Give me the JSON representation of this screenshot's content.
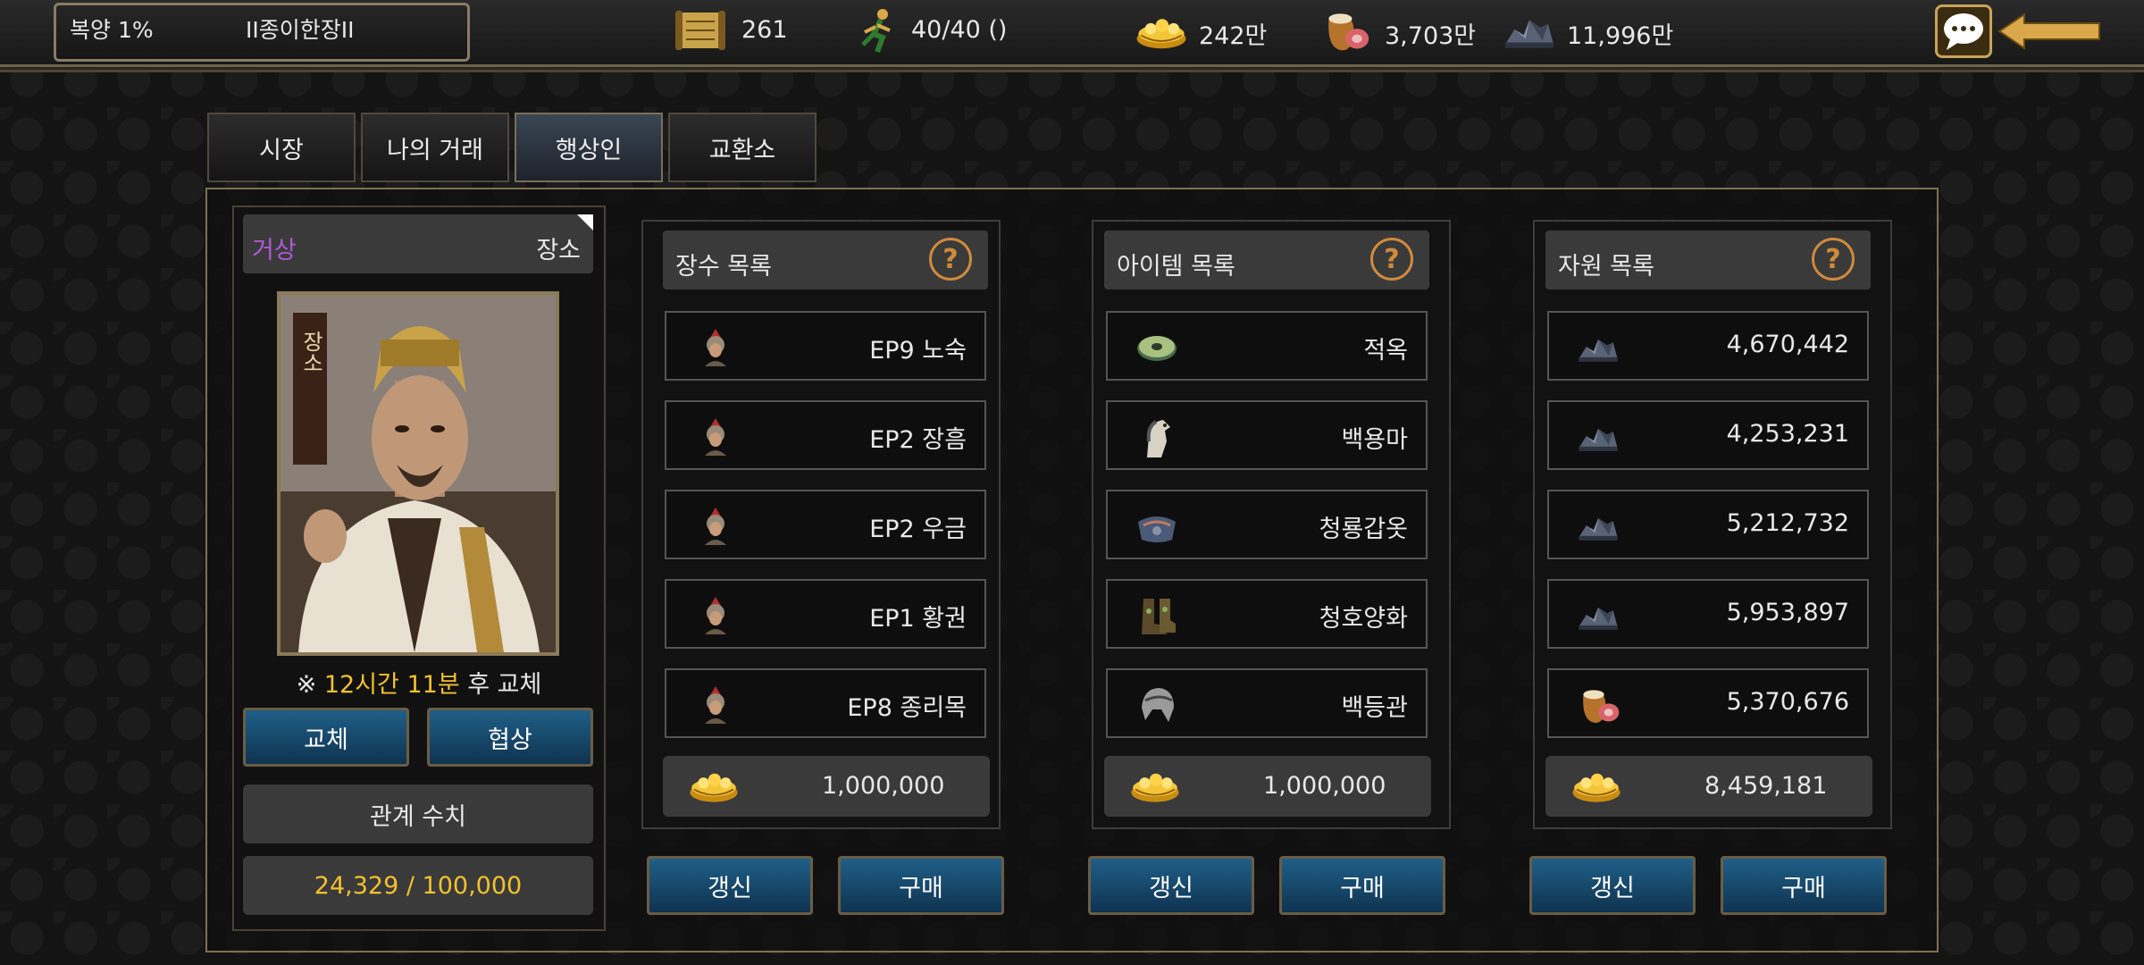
{
  "topbar": {
    "rate": "복양 1%",
    "server": "II종이한장II",
    "resources": [
      {
        "icon": "scroll-icon",
        "value": "261"
      },
      {
        "icon": "runner-icon",
        "value": "40/40 ()"
      },
      {
        "icon": "gold-ingot-icon",
        "value": "242만"
      },
      {
        "icon": "food-sack-icon",
        "value": "3,703만"
      },
      {
        "icon": "iron-ore-icon",
        "value": "11,996만"
      }
    ]
  },
  "tabs": [
    "시장",
    "나의 거래",
    "행상인",
    "교환소"
  ],
  "active_tab": "행상인",
  "merchant": {
    "grade": "거상",
    "name": "장소",
    "portrait_caption": "장소",
    "timer_prefix": "※ ",
    "timer_highlight": "12시간 11분",
    "timer_suffix": " 후 교체",
    "replace_label": "교체",
    "negotiate_label": "협상",
    "relation_label": "관계 수치",
    "relation_value": "24,329 / 100,000"
  },
  "columns": [
    {
      "title": "장수 목록",
      "rows": [
        {
          "icon": "general-icon",
          "label": "EP9 노숙"
        },
        {
          "icon": "general-icon",
          "label": "EP2 장흠"
        },
        {
          "icon": "general-icon",
          "label": "EP2 우금"
        },
        {
          "icon": "general-icon",
          "label": "EP1 황권"
        },
        {
          "icon": "general-icon",
          "label": "EP8 종리목"
        }
      ],
      "price": "1,000,000",
      "refresh_label": "갱신",
      "buy_label": "구매"
    },
    {
      "title": "아이템 목록",
      "rows": [
        {
          "icon": "jade-disc-icon",
          "label": "적옥"
        },
        {
          "icon": "horse-icon",
          "label": "백용마"
        },
        {
          "icon": "armor-icon",
          "label": "청룡갑옷"
        },
        {
          "icon": "boots-icon",
          "label": "청호양화"
        },
        {
          "icon": "helmet-icon",
          "label": "백등관"
        }
      ],
      "price": "1,000,000",
      "refresh_label": "갱신",
      "buy_label": "구매"
    },
    {
      "title": "자원 목록",
      "rows": [
        {
          "icon": "iron-ore-icon",
          "label": "4,670,442"
        },
        {
          "icon": "iron-ore-icon",
          "label": "4,253,231"
        },
        {
          "icon": "iron-ore-icon",
          "label": "5,212,732"
        },
        {
          "icon": "iron-ore-icon",
          "label": "5,953,897"
        },
        {
          "icon": "food-sack-icon",
          "label": "5,370,676"
        }
      ],
      "price": "8,459,181",
      "refresh_label": "갱신",
      "buy_label": "구매"
    }
  ],
  "colors": {
    "gold_text": "#f2c12e",
    "purple_grade": "#b05ad8",
    "blue_button": "#1f5f87"
  }
}
